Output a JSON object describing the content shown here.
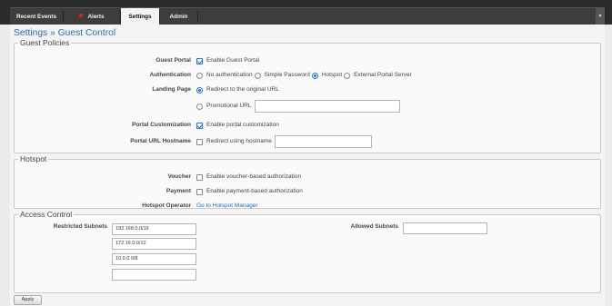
{
  "nav": {
    "tabs": [
      {
        "label": "Recent Events"
      },
      {
        "label": "Alerts"
      },
      {
        "label": "Settings"
      },
      {
        "label": "Admin"
      }
    ],
    "menu_icon": "chevron-down-icon"
  },
  "breadcrumb": "Settings » Guest Control",
  "guest_policies": {
    "legend": "Guest Policies",
    "guest_portal": {
      "label": "Guest Portal",
      "option": "Enable Guest Portal",
      "checked": true
    },
    "authentication": {
      "label": "Authentication",
      "options": [
        "No authentication",
        "Simple Password",
        "Hotspot",
        "External Portal Server"
      ],
      "selected": "Hotspot"
    },
    "landing_page": {
      "label": "Landing Page",
      "options": [
        "Redirect to the original URL",
        "Promotional URL"
      ],
      "selected": "Redirect to the original URL",
      "promotional_url_value": ""
    },
    "portal_customization": {
      "label": "Portal Customization",
      "option": "Enable portal customization",
      "checked": true
    },
    "portal_url_hostname": {
      "label": "Portal URL Hostname",
      "option": "Redirect using hostname",
      "checked": false,
      "value": ""
    }
  },
  "hotspot": {
    "legend": "Hotspot",
    "voucher": {
      "label": "Voucher",
      "option": "Enable voucher-based authorization",
      "checked": false
    },
    "payment": {
      "label": "Payment",
      "option": "Enable payment-based authorization",
      "checked": false
    },
    "operator": {
      "label": "Hotspot Operator",
      "link": "Go to Hotspot Manager"
    }
  },
  "access_control": {
    "legend": "Access Control",
    "restricted_label": "Restricted Subnets",
    "restricted_subnets": [
      "192.168.0.0/16",
      "172.16.0.0/12",
      "10.0.0.0/8",
      ""
    ],
    "allowed_label": "Allowed Subnets",
    "allowed_subnets": [
      ""
    ]
  },
  "apply_label": "Apply",
  "colors": {
    "accent": "#2a6db3",
    "alert": "#e02020",
    "topbar": "#2b2b2b"
  }
}
